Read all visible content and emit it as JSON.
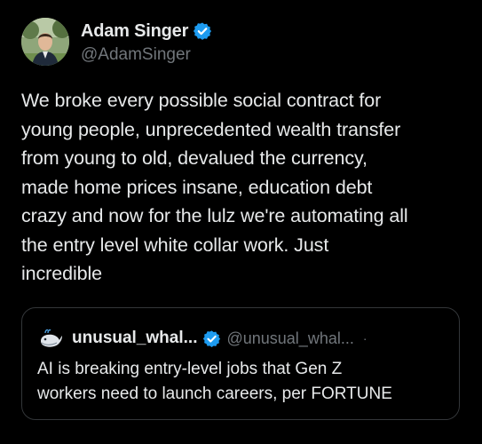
{
  "author": {
    "name": "Adam Singer",
    "handle": "@AdamSinger",
    "avatar_icon": "profile-photo"
  },
  "tweet": {
    "text": "We broke every possible social contract for\nyoung people, unprecedented wealth transfer\nfrom young to old, devalued the currency,\nmade home prices insane, education debt\ncrazy and now for the lulz we're automating all\nthe entry level white collar work. Just\nincredible"
  },
  "quoted": {
    "name": "unusual_whal...",
    "handle": "@unusual_whal...",
    "separator": "·",
    "text": "AI is breaking entry-level jobs that Gen Z\nworkers need to launch careers, per FORTUNE",
    "avatar_icon": "whale-icon"
  },
  "colors": {
    "background": "#000000",
    "text": "#e7e9ea",
    "secondary": "#71767b",
    "verified": "#1d9bf0",
    "border": "#333639"
  }
}
